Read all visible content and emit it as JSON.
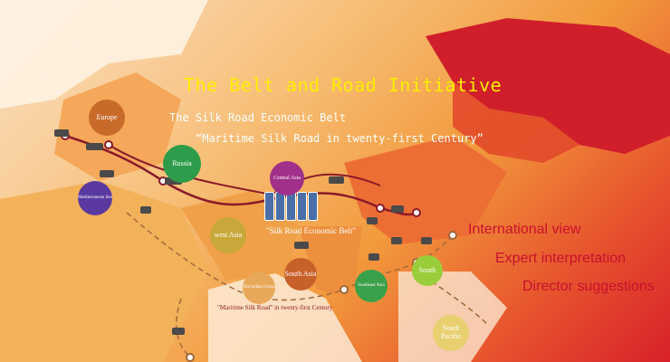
{
  "title": "The Belt and Road Initiative",
  "subtitle_belt": "The Silk Road Economic Belt",
  "subtitle_maritime": "“Maritime Silk Road in twenty-first Century”",
  "menu": {
    "international_view": "International view",
    "expert_interpretation": "Expert interpretation",
    "director_suggestions": "Director suggestions"
  },
  "route_labels": {
    "silk_road_belt": "\"Silk Road Economic Belt\"",
    "maritime_silk_road": "\"Maritime Silk Road\" in twenty-first Century"
  },
  "regions": {
    "europe": "Europe",
    "russia": "Russia",
    "mediterranean_sea": "Mediterranean Sea",
    "central_asia": "Central Asia",
    "west_asia": "west Asia",
    "south_asia": "South Asia",
    "indian_ocean": "The Indian Ocean",
    "southeast_asia": "Southeast Asia",
    "south": "South",
    "south_pacific": "South Pacific"
  },
  "colors": {
    "title": "#ffee00",
    "menu": "#c8102e",
    "route_land": "#8a1a2a",
    "route_sea": "#a06a3a",
    "europe": "#c86b2a",
    "russia": "#2e9c4a",
    "mediterranean": "#5a3aa0",
    "central_asia": "#a0308a",
    "west_asia": "#c8a83a",
    "south_asia": "#c8602a",
    "indian_ocean": "#e8a85a",
    "southeast_asia": "#3aa04a",
    "south": "#9acd3a",
    "south_pacific": "#e8d070"
  }
}
